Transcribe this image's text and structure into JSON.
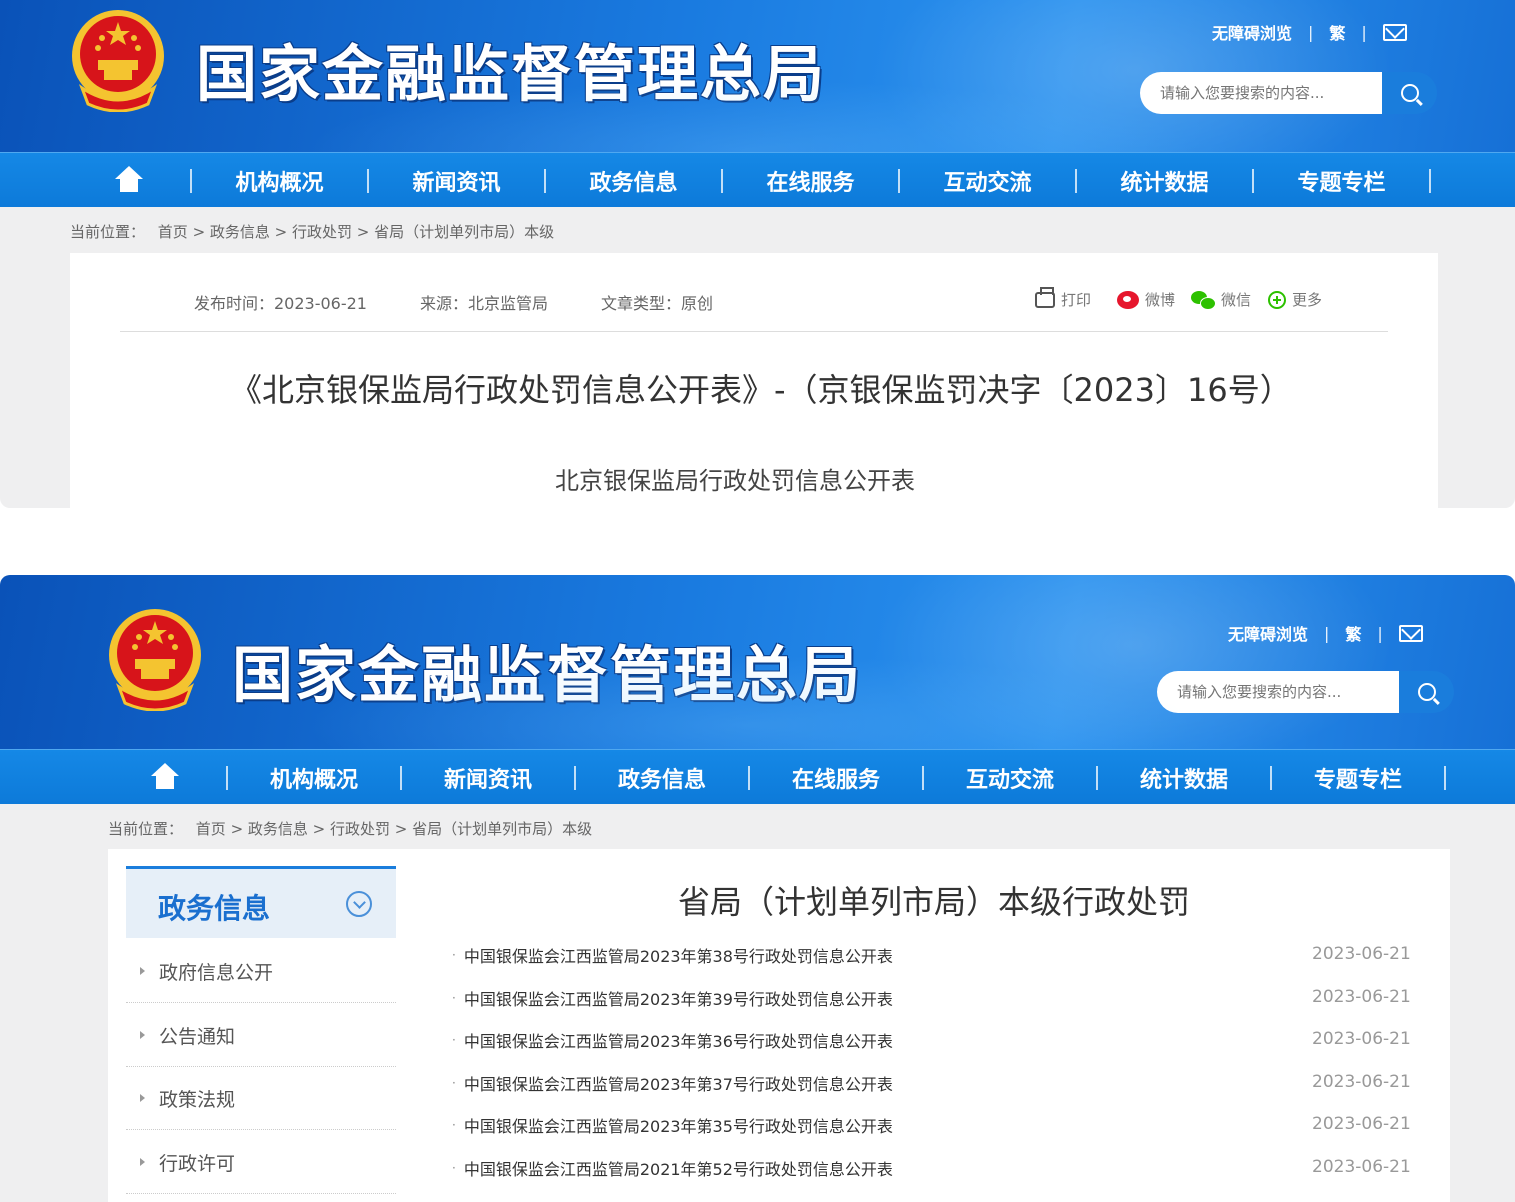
{
  "header": {
    "site_title": "国家金融监督管理总局",
    "accessible_label": "无障碍浏览",
    "traditional_label": "繁",
    "search_placeholder": "请输入您要搜索的内容..."
  },
  "nav": {
    "items": [
      "机构概况",
      "新闻资讯",
      "政务信息",
      "在线服务",
      "互动交流",
      "统计数据",
      "专题专栏"
    ]
  },
  "breadcrumb": {
    "prefix": "当前位置：",
    "path": "首页 > 政务信息 > 行政处罚 > 省局（计划单列市局）本级"
  },
  "article": {
    "publish_time": "发布时间：2023-06-21",
    "source": "来源：北京监管局",
    "type": "文章类型：原创",
    "print": "打印",
    "weibo": "微博",
    "wechat": "微信",
    "more": "更多",
    "title": "《北京银保监局行政处罚信息公开表》-（京银保监罚决字〔2023〕16号）",
    "subtitle": "北京银保监局行政处罚信息公开表"
  },
  "sidebar": {
    "heading": "政务信息",
    "items": [
      "政府信息公开",
      "公告通知",
      "政策法规",
      "行政许可"
    ]
  },
  "list": {
    "heading": "省局（计划单列市局）本级行政处罚",
    "rows": [
      {
        "title": "中国银保监会江西监管局2023年第38号行政处罚信息公开表",
        "date": "2023-06-21"
      },
      {
        "title": "中国银保监会江西监管局2023年第39号行政处罚信息公开表",
        "date": "2023-06-21"
      },
      {
        "title": "中国银保监会江西监管局2023年第36号行政处罚信息公开表",
        "date": "2023-06-21"
      },
      {
        "title": "中国银保监会江西监管局2023年第37号行政处罚信息公开表",
        "date": "2023-06-21"
      },
      {
        "title": "中国银保监会江西监管局2023年第35号行政处罚信息公开表",
        "date": "2023-06-21"
      },
      {
        "title": "中国银保监会江西监管局2021年第52号行政处罚信息公开表",
        "date": "2023-06-21"
      }
    ]
  },
  "colors": {
    "brand_blue": "#1a7ddc",
    "nav_blue": "#0d7ad9",
    "emblem_red": "#d7141a",
    "emblem_gold": "#f4c430"
  }
}
